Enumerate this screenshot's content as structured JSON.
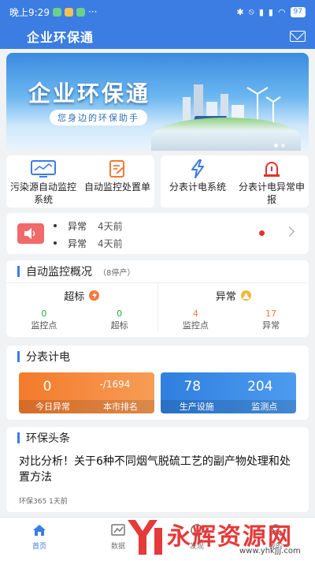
{
  "status_bar": {
    "time": "晚上9:29",
    "more": "···",
    "battery": "97"
  },
  "app": {
    "title": "企业环保通"
  },
  "banner": {
    "title": "企业环保通",
    "subtitle": "您身边的环保助手"
  },
  "shortcuts": [
    {
      "label": "污染源自动监控系统",
      "icon": "monitor-icon"
    },
    {
      "label": "自动监控处置单",
      "icon": "form-edit-icon"
    },
    {
      "label": "分表计电系统",
      "icon": "lightning-icon"
    },
    {
      "label": "分表计电异常申报",
      "icon": "alarm-lamp-icon"
    }
  ],
  "notices": [
    {
      "label": "异常",
      "time": "4天前"
    },
    {
      "label": "异常",
      "time": "4天前"
    }
  ],
  "auto_monitor": {
    "title": "自动监控概况",
    "subtitle": "（8停产）",
    "exceed": {
      "title": "超标",
      "stats": [
        {
          "value": "0",
          "label": "监控点"
        },
        {
          "value": "0",
          "label": "超标"
        }
      ]
    },
    "abnormal": {
      "title": "异常",
      "stats": [
        {
          "value": "4",
          "label": "监控点"
        },
        {
          "value": "17",
          "label": "异常"
        }
      ]
    }
  },
  "meter": {
    "title": "分表计电",
    "left": {
      "v1": "0",
      "v2": "-/1694",
      "l1": "今日异常",
      "l2": "本市排名"
    },
    "right": {
      "v1": "78",
      "v2": "204",
      "l1": "生产设施",
      "l2": "监测点"
    }
  },
  "news": {
    "title": "环保头条",
    "headline": "对比分析！关于6种不同烟气脱硫工艺的副产物处理和处置方法",
    "source": "环保365",
    "time": "1天前"
  },
  "tabs": [
    {
      "label": "首页",
      "active": true
    },
    {
      "label": "数据",
      "active": false
    },
    {
      "label": "发现",
      "active": false
    },
    {
      "label": "我的",
      "active": false
    }
  ],
  "watermark": {
    "text": "永辉资源网",
    "url": "www.yhkjjj.com"
  },
  "colors": {
    "primary": "#3b7de2",
    "orange": "#f47a2b",
    "green": "#27a844",
    "red": "#e03131"
  }
}
